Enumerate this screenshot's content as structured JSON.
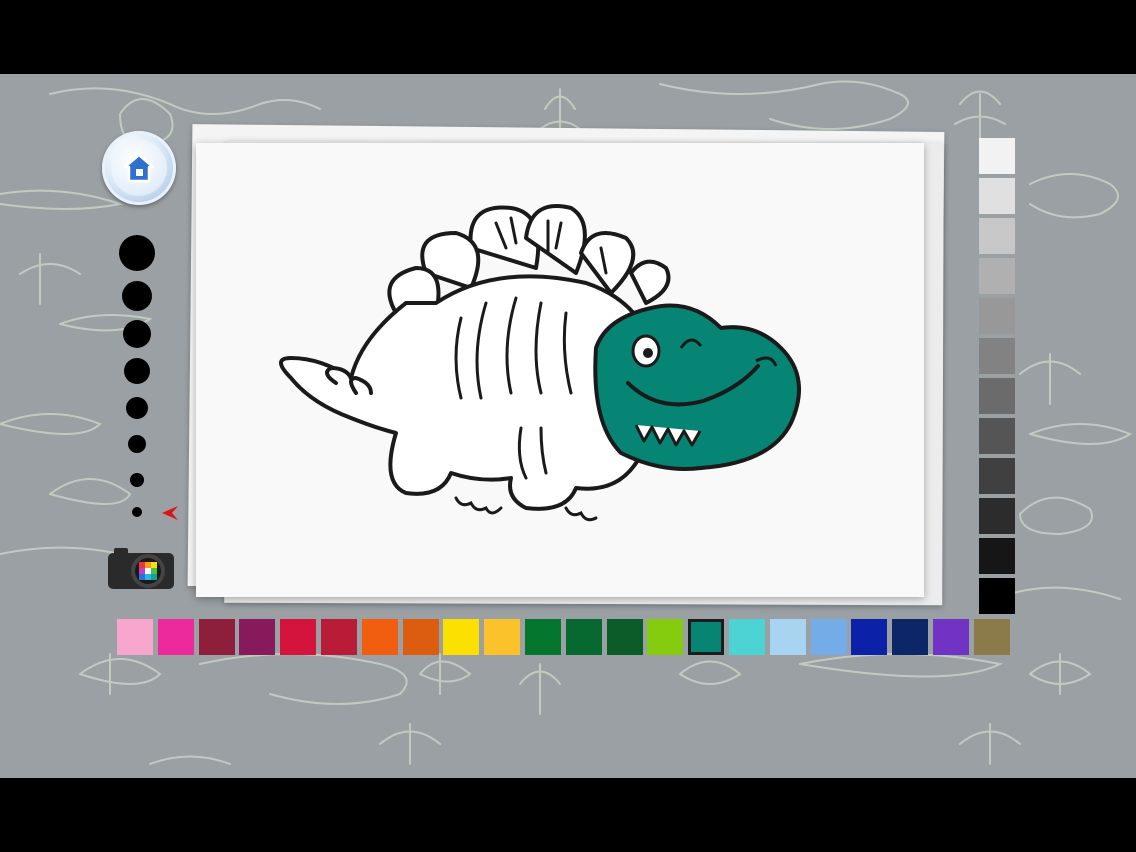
{
  "toolbar": {
    "home_icon": "home-icon",
    "camera_icon": "camera-palette-icon",
    "brush_sizes_count": 8,
    "selected_brush_size": 8,
    "pointer_icon": "red-arrow-pointer-icon"
  },
  "palette": {
    "selected_color": "#068474",
    "colors": [
      "#f9a6cf",
      "#ec2a9c",
      "#8e1f3b",
      "#861a5a",
      "#d4143c",
      "#b81c36",
      "#f25e0f",
      "#dc5c10",
      "#fce002",
      "#fcc22c",
      "#04762e",
      "#076830",
      "#0c5c2a",
      "#85cb0e",
      "#068474",
      "#4cd4d4",
      "#a8d4f2",
      "#74ace8",
      "#0b21a8",
      "#0d2668",
      "#7133c4",
      "#8b7a4a"
    ]
  },
  "grayscale": {
    "colors": [
      "#f2f2f2",
      "#e0e0e0",
      "#c8c8c8",
      "#b0b0b0",
      "#989898",
      "#828282",
      "#6b6b6b",
      "#555555",
      "#404040",
      "#2c2c2c",
      "#161616",
      "#000000"
    ]
  },
  "canvas": {
    "fill_color": "#068474",
    "subject": "stegosaurus-outline"
  }
}
